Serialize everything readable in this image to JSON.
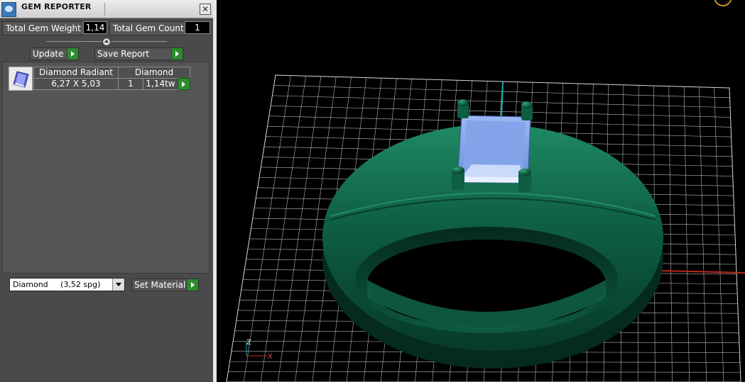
{
  "panel": {
    "title": "GEM REPORTER",
    "total_gem_weight_label": "Total Gem Weight",
    "total_gem_weight_value": "1,14",
    "total_gem_count_label": "Total Gem Count",
    "total_gem_count_value": "1",
    "update_label": "Update",
    "save_report_label": "Save Report",
    "gem_list": {
      "headers": [
        "Diamond Radiant",
        "Diamond"
      ],
      "rows": [
        {
          "size": "6,27 X 5,03",
          "count": "1",
          "weight": "1,14tw"
        }
      ]
    },
    "material_select": {
      "value": "Diamond     (3,52 spg)"
    },
    "set_material_label": "Set Material"
  },
  "viewport": {
    "axis_labels": {
      "z": "Z",
      "x": "X"
    },
    "colors": {
      "ring": "#0f5f45",
      "stone": "#8fb0ef",
      "grid": "#d8d8d8",
      "x_axis": "#c0271b",
      "z_axis": "#1aa3b5"
    }
  },
  "icons": [
    "gem-reporter-icon",
    "close-icon",
    "slider-knob-icon",
    "play-icon",
    "diamond-gem-icon",
    "dropdown-arrow-icon"
  ]
}
